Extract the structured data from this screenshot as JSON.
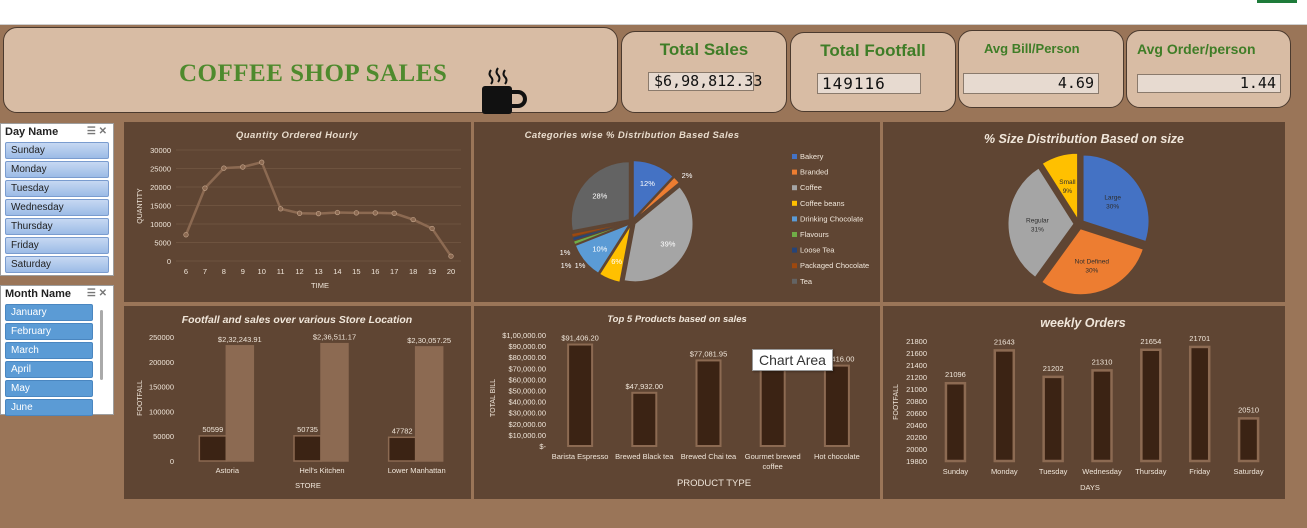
{
  "dashboard": {
    "title": "COFFEE SHOP SALES",
    "kpis": [
      {
        "label": "Total Sales",
        "value": "$6,98,812.33"
      },
      {
        "label": "Total Footfall",
        "value": "149116"
      },
      {
        "label": "Avg Bill/Person",
        "value": "4.69"
      },
      {
        "label": "Avg Order/person",
        "value": "1.44"
      }
    ],
    "tooltip": "Chart Area"
  },
  "slicers": {
    "day": {
      "title": "Day Name",
      "items": [
        "Sunday",
        "Monday",
        "Tuesday",
        "Wednesday",
        "Thursday",
        "Friday",
        "Saturday"
      ]
    },
    "month": {
      "title": "Month Name",
      "items": [
        "January",
        "February",
        "March",
        "April",
        "May",
        "June"
      ]
    }
  },
  "colors": {
    "background": "#9a7558",
    "panel": "#5f4533",
    "bar_dark": "#3b2314",
    "bar_light": "#8c6a52",
    "line": "#8c6a52",
    "title_green": "#4e8a2d"
  },
  "chart_data": [
    {
      "id": "hourly",
      "type": "line",
      "title": "Quantity Ordered Hourly",
      "xlabel": "TIME",
      "ylabel": "QUANTITY",
      "x": [
        6,
        7,
        8,
        9,
        10,
        11,
        12,
        13,
        14,
        15,
        16,
        17,
        18,
        19,
        20
      ],
      "values": [
        7100,
        19700,
        25100,
        25400,
        26700,
        14100,
        12900,
        12800,
        13100,
        13000,
        13000,
        12900,
        11200,
        8800,
        1300
      ],
      "ylim": [
        0,
        30000
      ],
      "yticks": [
        0,
        5000,
        10000,
        15000,
        20000,
        25000,
        30000
      ]
    },
    {
      "id": "categories",
      "type": "pie",
      "title": "Categories wise % Distribution Based Sales",
      "slices": [
        {
          "name": "Bakery",
          "value": 12,
          "label": "12%",
          "color": "#4472c4"
        },
        {
          "name": "Branded",
          "value": 2,
          "label": "2%",
          "color": "#ed7d31"
        },
        {
          "name": "Coffee",
          "value": 39,
          "label": "39%",
          "color": "#a5a5a5"
        },
        {
          "name": "Coffee beans",
          "value": 6,
          "label": "6%",
          "color": "#ffc000"
        },
        {
          "name": "Drinking Chocolate",
          "value": 10,
          "label": "10%",
          "color": "#5b9bd5"
        },
        {
          "name": "Flavours",
          "value": 1,
          "label": "1%",
          "color": "#70ad47"
        },
        {
          "name": "Loose Tea",
          "value": 1,
          "label": "1%",
          "color": "#264478"
        },
        {
          "name": "Packaged Chocolate",
          "value": 1,
          "label": "1%",
          "color": "#9e480e"
        },
        {
          "name": "Tea",
          "value": 28,
          "label": "28%",
          "color": "#636363"
        }
      ]
    },
    {
      "id": "sizes",
      "type": "pie",
      "title": "% Size Distribution Based on size",
      "slices": [
        {
          "name": "Large",
          "value": 30,
          "label": "30%",
          "color": "#4472c4"
        },
        {
          "name": "Not Defined",
          "value": 30,
          "label": "30%",
          "color": "#ed7d31"
        },
        {
          "name": "Regular",
          "value": 31,
          "label": "31%",
          "color": "#a5a5a5"
        },
        {
          "name": "Small",
          "value": 9,
          "label": "9%",
          "color": "#ffc000"
        }
      ]
    },
    {
      "id": "stores",
      "type": "bar",
      "title": "Footfall and sales over various Store Location",
      "xlabel": "STORE",
      "ylabel": "FOOTFALL",
      "categories": [
        "Astoria",
        "Hell's Kitchen",
        "Lower Manhattan"
      ],
      "series": [
        {
          "name": "Footfall",
          "values": [
            50599,
            50735,
            47782
          ],
          "labels": [
            "50599",
            "50735",
            "47782"
          ]
        },
        {
          "name": "Sales",
          "values": [
            232243.91,
            236511.17,
            230057.25
          ],
          "labels": [
            "$2,32,243.91",
            "$2,36,511.17",
            "$2,30,057.25"
          ]
        }
      ],
      "ylim": [
        0,
        250000
      ],
      "yticks": [
        0,
        50000,
        100000,
        150000,
        200000,
        250000
      ]
    },
    {
      "id": "products",
      "type": "bar",
      "title": "Top 5 Products based on sales",
      "xlabel": "PRODUCT TYPE",
      "ylabel": "TOTAL BILL",
      "categories": [
        "Barista Espresso",
        "Brewed Black tea",
        "Brewed Chai tea",
        "Gourmet brewed coffee",
        "Hot chocolate"
      ],
      "category_lines": [
        [
          "Barista Espresso"
        ],
        [
          "Brewed Black tea"
        ],
        [
          "Brewed Chai tea"
        ],
        [
          "Gourmet brewed",
          "coffee"
        ],
        [
          "Hot chocolate"
        ]
      ],
      "values": [
        91406.2,
        47932.0,
        77081.95,
        70034.6,
        72416.0
      ],
      "data_labels": [
        "$91,406.20",
        "$47,932.00",
        "$77,081.95",
        "",
        "416.00"
      ],
      "ylim": [
        0,
        100000
      ],
      "yticks": [
        0,
        10000,
        20000,
        30000,
        40000,
        50000,
        60000,
        70000,
        80000,
        90000,
        100000
      ],
      "ytick_labels": [
        "$-",
        "$10,000.00",
        "$20,000.00",
        "$30,000.00",
        "$40,000.00",
        "$50,000.00",
        "$60,000.00",
        "$70,000.00",
        "$80,000.00",
        "$90,000.00",
        "$1,00,000.00"
      ]
    },
    {
      "id": "weekly",
      "type": "bar",
      "title": "weekly Orders",
      "xlabel": "DAYS",
      "ylabel": "FOOTFALL",
      "categories": [
        "Sunday",
        "Monday",
        "Tuesday",
        "Wednesday",
        "Thursday",
        "Friday",
        "Saturday"
      ],
      "values": [
        21096,
        21643,
        21202,
        21310,
        21654,
        21701,
        20510
      ],
      "ylim": [
        19800,
        21800
      ],
      "yticks": [
        19800,
        20000,
        20200,
        20400,
        20600,
        20800,
        21000,
        21200,
        21400,
        21600,
        21800
      ]
    }
  ]
}
